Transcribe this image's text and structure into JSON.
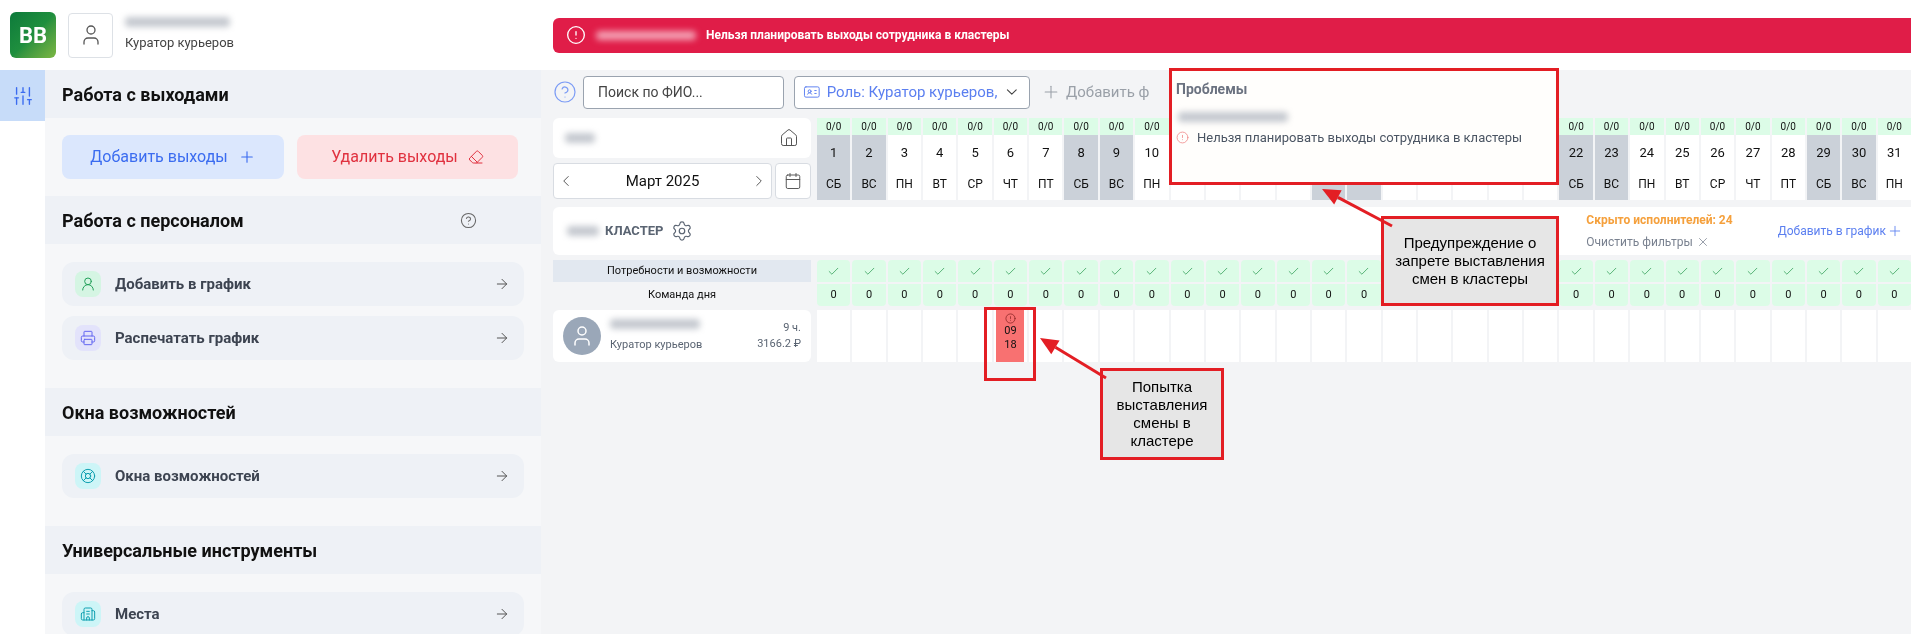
{
  "header": {
    "logo_text": "BB",
    "user_role": "Куратор курьеров"
  },
  "banner": {
    "message": "Нельзя планировать выходы сотрудника в кластеры"
  },
  "sidebar": {
    "sections": [
      {
        "kind": "buttons",
        "title": "Работа с выходами",
        "add_label": "Добавить выходы",
        "delete_label": "Удалить выходы"
      },
      {
        "kind": "list",
        "title": "Работа с персоналом",
        "help": true,
        "items": [
          {
            "kind": "user",
            "label": "Добавить в график"
          },
          {
            "kind": "printer",
            "label": "Распечатать график"
          }
        ]
      },
      {
        "kind": "list",
        "title": "Окна возможностей",
        "help": false,
        "items": [
          {
            "kind": "lifebuoy",
            "label": "Окна возможностей"
          }
        ]
      },
      {
        "kind": "list",
        "title": "Универсальные инструменты",
        "help": false,
        "items": [
          {
            "kind": "building",
            "label": "Места"
          }
        ]
      }
    ]
  },
  "toolbar": {
    "search": {
      "placeholder": "Поиск по ФИО..."
    },
    "role_filter": "Роль: Куратор курьеров,",
    "add_filter": "Добавить ф"
  },
  "calendar": {
    "month": "Март 2025"
  },
  "days": [
    {
      "load": "0/0",
      "number": "1",
      "weekday": "СБ",
      "weekend": true,
      "need_ok": true,
      "team": "0"
    },
    {
      "load": "0/0",
      "number": "2",
      "weekday": "ВС",
      "weekend": true,
      "need_ok": true,
      "team": "0"
    },
    {
      "load": "0/0",
      "number": "3",
      "weekday": "ПН",
      "weekend": false,
      "need_ok": true,
      "team": "0"
    },
    {
      "load": "0/0",
      "number": "4",
      "weekday": "ВТ",
      "weekend": false,
      "need_ok": true,
      "team": "0"
    },
    {
      "load": "0/0",
      "number": "5",
      "weekday": "СР",
      "weekend": false,
      "need_ok": true,
      "team": "0"
    },
    {
      "load": "0/0",
      "number": "6",
      "weekday": "ЧТ",
      "weekend": false,
      "need_ok": true,
      "team": "0"
    },
    {
      "load": "0/0",
      "number": "7",
      "weekday": "ПТ",
      "weekend": false,
      "need_ok": true,
      "team": "0"
    },
    {
      "load": "0/0",
      "number": "8",
      "weekday": "СБ",
      "weekend": true,
      "need_ok": true,
      "team": "0"
    },
    {
      "load": "0/0",
      "number": "9",
      "weekday": "ВС",
      "weekend": true,
      "need_ok": true,
      "team": "0"
    },
    {
      "load": "0/0",
      "number": "10",
      "weekday": "ПН",
      "weekend": false,
      "need_ok": true,
      "team": "0"
    },
    {
      "weekend": false,
      "need_ok": true,
      "team": "0"
    },
    {
      "weekend": false,
      "need_ok": true,
      "team": "0"
    },
    {
      "weekend": false,
      "need_ok": true,
      "team": "0"
    },
    {
      "weekend": false,
      "need_ok": true,
      "team": "0"
    },
    {
      "weekend": true,
      "need_ok": true,
      "team": "0"
    },
    {
      "weekend": true,
      "need_ok": true,
      "team": "0"
    },
    {
      "weekend": false
    },
    {
      "weekend": false
    },
    {
      "weekend": false
    },
    {
      "weekend": false
    },
    {
      "weekend": false
    },
    {
      "load": "0/0",
      "number": "22",
      "weekday": "СБ",
      "weekend": true,
      "need_ok": true,
      "team": "0"
    },
    {
      "load": "0/0",
      "number": "23",
      "weekday": "ВС",
      "weekend": true,
      "need_ok": true,
      "team": "0"
    },
    {
      "load": "0/0",
      "number": "24",
      "weekday": "ПН",
      "weekend": false,
      "need_ok": true,
      "team": "0"
    },
    {
      "load": "0/0",
      "number": "25",
      "weekday": "ВТ",
      "weekend": false,
      "need_ok": true,
      "team": "0"
    },
    {
      "load": "0/0",
      "number": "26",
      "weekday": "СР",
      "weekend": false,
      "need_ok": true,
      "team": "0"
    },
    {
      "load": "0/0",
      "number": "27",
      "weekday": "ЧТ",
      "weekend": false,
      "need_ok": true,
      "team": "0"
    },
    {
      "load": "0/0",
      "number": "28",
      "weekday": "ПТ",
      "weekend": false,
      "need_ok": true,
      "team": "0"
    },
    {
      "load": "0/0",
      "number": "29",
      "weekday": "СБ",
      "weekend": true,
      "need_ok": true,
      "team": "0"
    },
    {
      "load": "0/0",
      "number": "30",
      "weekday": "ВС",
      "weekend": true,
      "need_ok": true,
      "team": "0"
    },
    {
      "load": "0/0",
      "number": "31",
      "weekday": "ПН",
      "weekend": false,
      "need_ok": true,
      "team": "0"
    }
  ],
  "cluster": {
    "title": "КЛАСТЕР",
    "hidden_count": "Скрыто исполнителей: 24",
    "clear_filters": "Очистить фильтры",
    "add_to_schedule": "Добавить в график"
  },
  "rows": {
    "needs_label": "Потребности и возможности",
    "team_label": "Команда дня"
  },
  "employees": [
    {
      "role": "Куратор курьеров",
      "hours": "9 ч.",
      "cost": "3166.2 ₽",
      "cells": [
        {
          "kind": "empty"
        },
        {
          "kind": "empty"
        },
        {
          "kind": "empty"
        },
        {
          "kind": "empty"
        },
        {
          "kind": "empty"
        },
        {
          "kind": "shift",
          "start": "09",
          "end": "18",
          "error": true
        },
        {
          "kind": "empty"
        },
        {
          "kind": "empty"
        },
        {
          "kind": "empty"
        },
        {
          "kind": "empty"
        },
        {
          "kind": "empty"
        },
        {
          "kind": "empty"
        },
        {
          "kind": "empty"
        },
        {
          "kind": "empty"
        },
        {
          "kind": "empty"
        },
        {
          "kind": "empty"
        },
        {
          "kind": "empty"
        },
        {
          "kind": "empty"
        },
        {
          "kind": "empty"
        },
        {
          "kind": "empty"
        },
        {
          "kind": "empty"
        },
        {
          "kind": "empty"
        },
        {
          "kind": "empty"
        },
        {
          "kind": "empty"
        },
        {
          "kind": "empty"
        },
        {
          "kind": "empty"
        },
        {
          "kind": "empty"
        },
        {
          "kind": "empty"
        },
        {
          "kind": "empty"
        },
        {
          "kind": "empty"
        },
        {
          "kind": "empty"
        }
      ]
    }
  ],
  "problems_popover": {
    "title": "Проблемы",
    "message": "Нельзя планировать выходы сотрудника в кластеры"
  },
  "callouts": [
    {
      "text": "Предупреждение о запрете выставления смен в кластеры"
    },
    {
      "text": "Попытка выставления смены в кластере"
    }
  ]
}
